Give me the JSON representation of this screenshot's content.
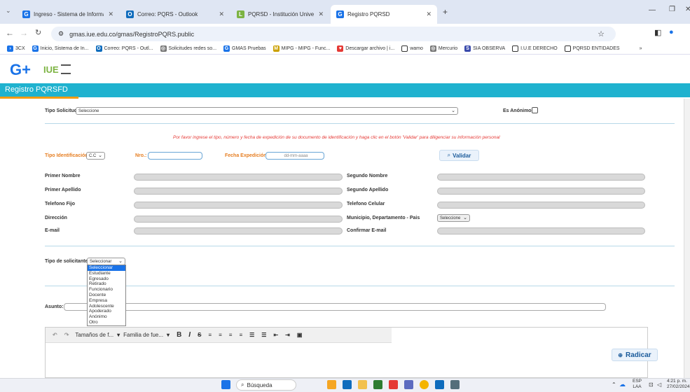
{
  "browser": {
    "tabs": [
      {
        "title": "Ingreso - Sistema de Informaci",
        "icon": "gmas-icon"
      },
      {
        "title": "Correo: PQRS - Outlook",
        "icon": "outlook-icon"
      },
      {
        "title": "PQRSD - Institución Universitar",
        "icon": "iue-icon"
      },
      {
        "title": "Registro PQRSD",
        "icon": "gmas-icon",
        "active": true
      }
    ],
    "new_tab": "+",
    "url": "gmas.iue.edu.co/gmas/RegistroPQRS.public",
    "bookmarks": [
      "3CX",
      "Inicio, Sistema de In...",
      "Correo: PQRS - Outl...",
      "Solicitudes redes so...",
      "GMAS Pruebas",
      "MIPG - MIPG - Func...",
      "Descargar archivo | i...",
      "wamo",
      "Mercurio",
      "SIA OBSERVA",
      "I.U.E DERECHO",
      "PQRSD ENTIDADES"
    ],
    "bookmarks_more": "»"
  },
  "page": {
    "logo_text": "G+",
    "iue_logo": "IUE",
    "banner_title": "Registro PQRSFD",
    "tipo_solicitud_label": "Tipo Solicitud",
    "tipo_solicitud_value": "Seleccione",
    "anonimo_label": "Es Anónimo:",
    "instruction": "Por favor ingrese el tipo, número y fecha de expedición de su documento de identificación y haga clic en el botón 'Validar' para diligenciar su información personal",
    "tipo_id_label": "Tipo Identificación",
    "tipo_id_value": "C.C",
    "nro_label": "Nro.:",
    "fecha_label": "Fecha Expedición",
    "fecha_placeholder": "dd-mm-aaaa",
    "validar_label": "Validar",
    "fields_left": [
      "Primer Nombre",
      "Primer Apellido",
      "Telefono Fijo",
      "Dirección",
      "E-mail"
    ],
    "fields_right": [
      "Segundo Nombre",
      "Segundo Apellido",
      "Telefono Celular",
      "Municipio, Departamento - Pais",
      "Confirmar E-mail"
    ],
    "municipio_value": "Seleccione",
    "solicitante_label": "Tipo de solicitante",
    "solicitante_value": "Seleccionar",
    "solicitante_options": [
      "Seleccionar",
      "Estudiante",
      "Egresado",
      "Retirado",
      "Funcionario",
      "Docente",
      "Empresa",
      "Adolescente",
      "Apoderado",
      "Anónimo",
      "Otro"
    ],
    "asunto_label": "Asunto:",
    "toolbar": {
      "font_size": "Tamaños de f...",
      "font_family": "Familia de fue..."
    },
    "radicar_label": "Radicar"
  },
  "taskbar": {
    "search": "Búsqueda",
    "lang": "ESP",
    "lang2": "LAA",
    "time": "4:21 p. m.",
    "date": "27/02/2024"
  },
  "colors": {
    "accent": "#1fb2cf",
    "orange": "#e67e22",
    "red": "#e53935"
  }
}
